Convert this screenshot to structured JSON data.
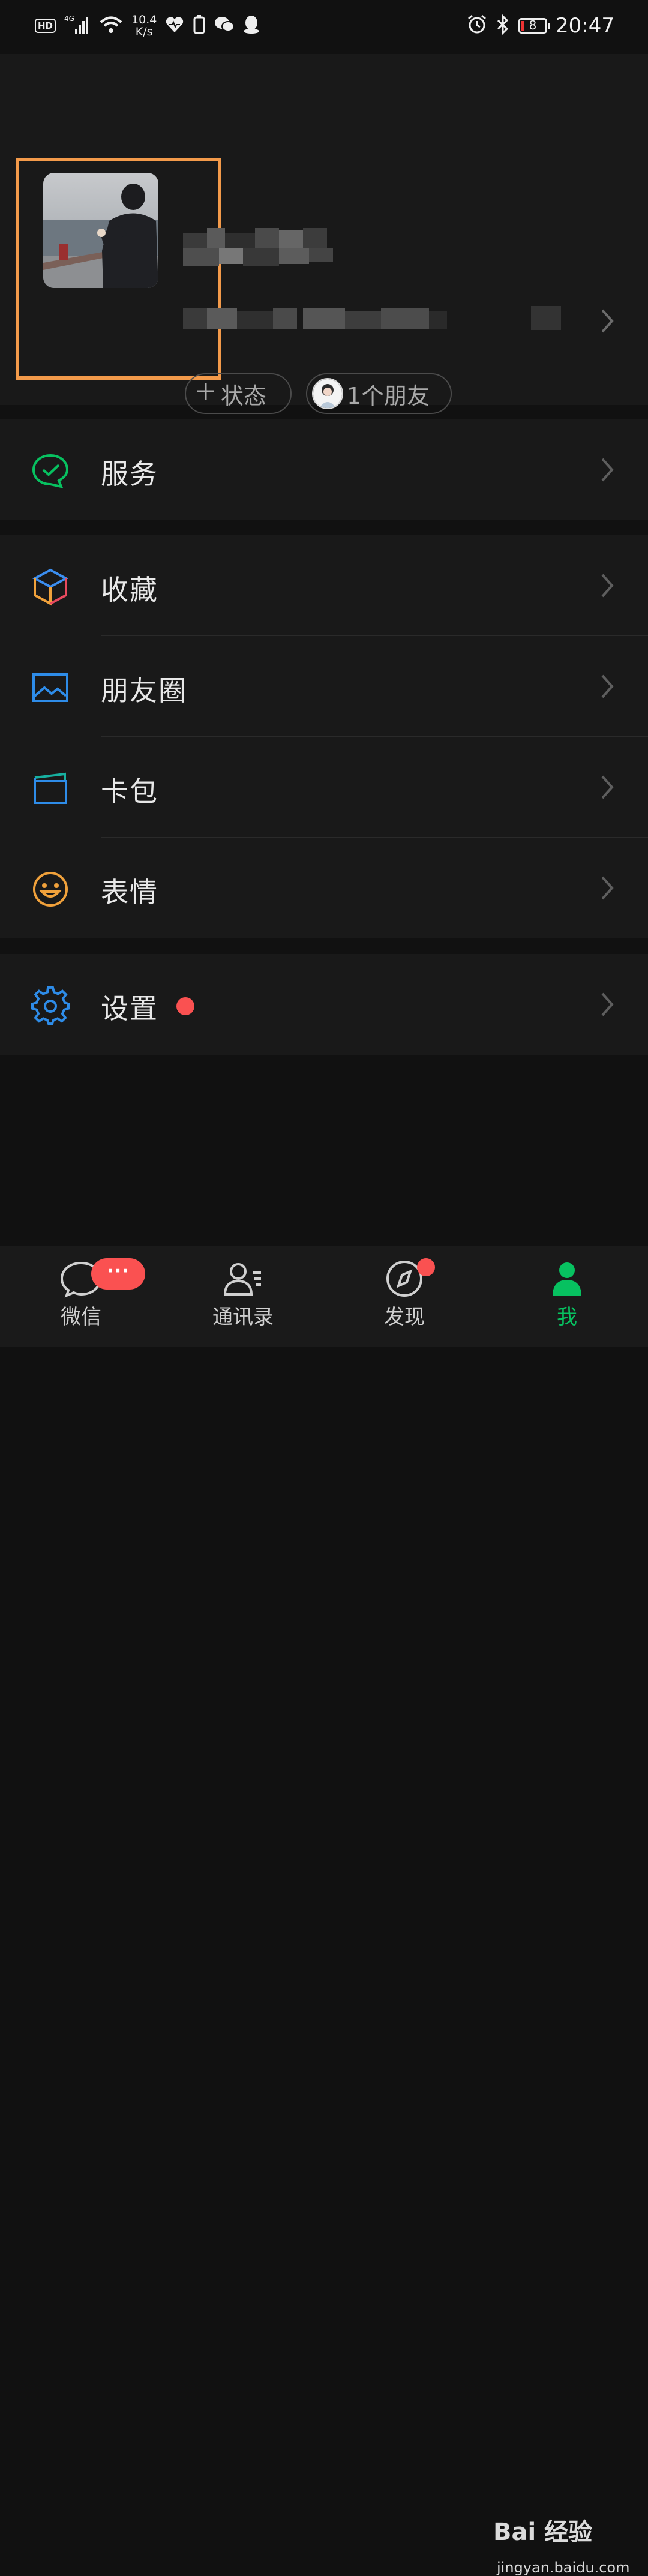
{
  "status_bar": {
    "hd": "HD",
    "network": "4G",
    "speed_value": "10.4",
    "speed_unit": "K/s",
    "battery": "8",
    "time": "20:47"
  },
  "profile": {
    "status_button": "状态",
    "friends_button": "1个朋友"
  },
  "menu": {
    "services": "服务",
    "favorites": "收藏",
    "moments": "朋友圈",
    "cards": "卡包",
    "stickers": "表情",
    "settings": "设置"
  },
  "tabbar": {
    "chats": "微信",
    "contacts": "通讯录",
    "discover": "发现",
    "me": "我",
    "chats_badge": "···"
  },
  "watermark": {
    "logo": "Bai 经验",
    "url": "jingyan.baidu.com"
  },
  "colors": {
    "accent_green": "#07c160",
    "badge_red": "#fa5151",
    "highlight_orange": "#f39a4a",
    "background": "#111111",
    "card": "#191919"
  }
}
